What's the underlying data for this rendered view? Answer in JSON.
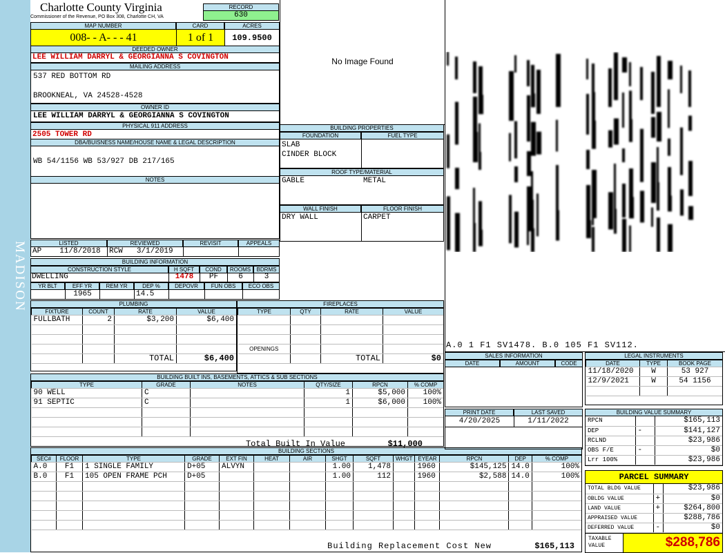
{
  "header": {
    "county": "Charlotte County Virginia",
    "commissioner": "Commissioner of the Revenue, PO Box 308, Charlotte CH, VA",
    "record_label": "RECORD",
    "record": "630",
    "map_label": "MAP NUMBER",
    "map": "008- - A- - - 41",
    "card_label": "CARD",
    "card": "1 of 1",
    "acres_label": "ACRES",
    "acres": "109.9500"
  },
  "owner": {
    "deeded_label": "DEEDED OWNER",
    "deeded": "LEE WILLIAM DARRYL & GEORGIANNA S COVINGTON",
    "mailing_label": "MAILING ADDRESS",
    "mail1": "537 RED BOTTOM RD",
    "mail2": "BROOKNEAL, VA 24528-4528",
    "ownerid_label": "OWNER ID",
    "ownerid": "LEE WILLIAM DARRYL & GEORGIANNA S COVINGTON",
    "phys_label": "PHYSICAL 911 ADDRESS",
    "phys": "2505 TOWER RD"
  },
  "legal": {
    "label": "DBA/BUISNESS NAME/HOUSE NAME & LEGAL DESCRIPTION",
    "text": "WB 54/1156 WB 53/927 DB 217/165"
  },
  "notes_label": "NOTES",
  "photo": "No Image Found",
  "district": "MADISON",
  "sketch_labels": "A.0 1 F1 SV1478. B.0 105 F1 SV112.",
  "listed": {
    "h_listed": "LISTED",
    "h_reviewed": "REVIEWED",
    "h_revisit": "REVISIT",
    "h_appeals": "APPEALS",
    "listed_by": "AP",
    "listed_date": "11/8/2018",
    "reviewed_by": "RCW",
    "reviewed_date": "3/1/2019"
  },
  "bldg_info": {
    "label": "BUILDING INFORMATION",
    "h_style": "CONSTRUCTION STYLE",
    "h_hsqft": "H SQFT",
    "h_cond": "COND",
    "h_rooms": "ROOMS",
    "h_bdrms": "BDRMS",
    "style": "DWELLING",
    "hsqft": "1478",
    "cond": "PF",
    "rooms": "6",
    "bdrms": "3",
    "h_yrblt": "YR BLT",
    "h_effyr": "EFF YR",
    "h_remyr": "REM YR",
    "h_dep": "DEP %",
    "h_depovr": "DEPOVR",
    "h_funobs": "FUN OBS",
    "h_ecoobs": "ECO OBS",
    "effyr": "1965",
    "dep": "14.5"
  },
  "bldg_props": {
    "label": "BUILDING PROPERTIES",
    "h_found": "FOUNDATION",
    "h_fuel": "FUEL TYPE",
    "found1": "SLAB",
    "found2": "CINDER BLOCK",
    "h_roof": "ROOF TYPE/MATERIAL",
    "roof_type": "GABLE",
    "roof_mat": "METAL",
    "h_wall": "WALL FINISH",
    "h_floor": "FLOOR FINISH",
    "wall": "DRY WALL",
    "floor": "CARPET"
  },
  "plumbing": {
    "label": "PLUMBING",
    "h_fixture": "FIXTURE",
    "h_count": "COUNT",
    "h_rate": "RATE",
    "h_value": "VALUE",
    "fixture": "FULLBATH",
    "count": "2",
    "rate": "$3,200",
    "value": "$6,400",
    "total_label": "TOTAL",
    "total": "$6,400"
  },
  "fireplaces": {
    "label": "FIREPLACES",
    "h_type": "TYPE",
    "h_qty": "QTY",
    "h_rate": "RATE",
    "h_value": "VALUE",
    "openings": "OPENINGS",
    "total_label": "TOTAL",
    "total": "$0"
  },
  "builtins": {
    "label": "BUILDING BUILT INS, BASEMENTS, ATTICS & SUB SECTIONS",
    "h_type": "TYPE",
    "h_grade": "GRADE",
    "h_notes": "NOTES",
    "h_qty": "QTY/SIZE",
    "h_rpcn": "RPCN",
    "h_comp": "% COMP",
    "rows": [
      {
        "type": "90 WELL",
        "grade": "C",
        "qty": "1",
        "rpcn": "$5,000",
        "comp": "100%"
      },
      {
        "type": "91 SEPTIC",
        "grade": "C",
        "qty": "1",
        "rpcn": "$6,000",
        "comp": "100%"
      }
    ],
    "total_label": "Total Built In Value",
    "total": "$11,000"
  },
  "sections": {
    "label": "BUILDING SECTIONS",
    "headers": [
      "SEC#",
      "FLOOR",
      "TYPE",
      "GRADE",
      "EXT FIN",
      "HEAT",
      "AIR",
      "SHGT",
      "SQFT",
      "WHGT",
      "EYEAR",
      "RPCN",
      "DEP",
      "% COMP"
    ],
    "rows": [
      [
        "A.0",
        "F1",
        "1 SINGLE FAMILY",
        "D+05",
        "ALVYN",
        "",
        "",
        "1.00",
        "1,478",
        "",
        "1960",
        "$145,125",
        "14.0",
        "100%"
      ],
      [
        "B.0",
        "F1",
        "105 OPEN FRAME PCH",
        "D+05",
        "",
        "",
        "",
        "1.00",
        "112",
        "",
        "1960",
        "$2,588",
        "14.0",
        "100%"
      ]
    ],
    "brcn_label": "Building Replacement Cost New",
    "brcn": "$165,113"
  },
  "sales": {
    "label": "SALES INFORMATION",
    "h_date": "DATE",
    "h_amount": "AMOUNT",
    "h_code": "CODE"
  },
  "legal_inst": {
    "label": "LEGAL INSTRUMENTS",
    "h_date": "DATE",
    "h_type": "TYPE",
    "h_book": "BOOK PAGE",
    "rows": [
      [
        "11/18/2020",
        "W",
        "53 927"
      ],
      [
        "12/9/2021",
        "W",
        "54 1156"
      ]
    ]
  },
  "print": {
    "h_print": "PRINT DATE",
    "h_saved": "LAST SAVED",
    "print": "4/20/2025",
    "saved": "1/11/2022"
  },
  "bvs": {
    "label": "BUILDING VALUE SUMMARY",
    "rows": [
      [
        "RPCN",
        "",
        "$165,113"
      ],
      [
        "DEP",
        "-",
        "$141,127"
      ],
      [
        "RCLND",
        "",
        "$23,986"
      ],
      [
        "OBS F/E",
        "-",
        "$0"
      ],
      [
        "Lrr 100%",
        "",
        "$23,986"
      ]
    ]
  },
  "parcel": {
    "label": "PARCEL SUMMARY",
    "rows": [
      [
        "TOTAL BLDG VALUE",
        "",
        "$23,986"
      ],
      [
        "OBLDG VALUE",
        "+",
        "$0"
      ],
      [
        "LAND VALUE",
        "+",
        "$264,800"
      ],
      [
        "APPRAISED VALUE",
        "",
        "$288,786"
      ],
      [
        "DEFERRED VALUE",
        "-",
        "$0"
      ]
    ],
    "taxable_label": "TAXABLE VALUE",
    "taxable": "$288,786"
  }
}
